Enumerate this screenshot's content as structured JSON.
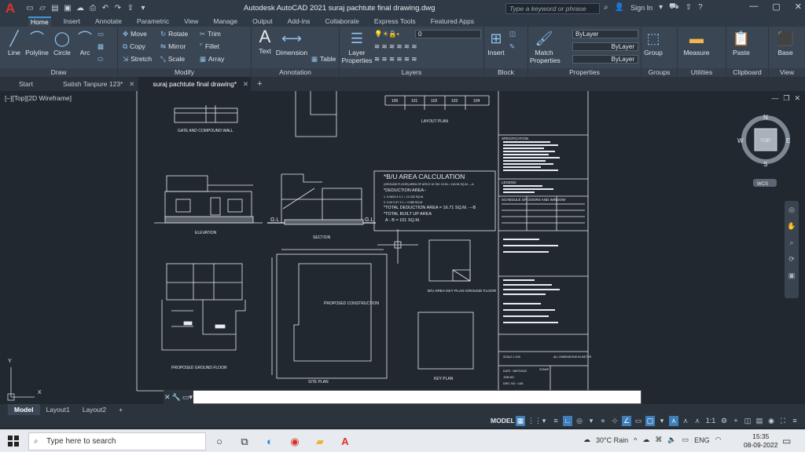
{
  "app": {
    "title": "Autodesk AutoCAD 2021   suraj pachtute final drawing.dwg",
    "search_placeholder": "Type a keyword or phrase",
    "sign_in": "Sign In"
  },
  "ribbon_tabs": [
    "Home",
    "Insert",
    "Annotate",
    "Parametric",
    "View",
    "Manage",
    "Output",
    "Add-ins",
    "Collaborate",
    "Express Tools",
    "Featured Apps"
  ],
  "panels": {
    "draw": {
      "title": "Draw",
      "line": "Line",
      "polyline": "Polyline",
      "circle": "Circle",
      "arc": "Arc"
    },
    "modify": {
      "title": "Modify",
      "move": "Move",
      "rotate": "Rotate",
      "trim": "Trim",
      "copy": "Copy",
      "mirror": "Mirror",
      "fillet": "Fillet",
      "stretch": "Stretch",
      "scale": "Scale",
      "array": "Array"
    },
    "annotation": {
      "title": "Annotation",
      "text": "Text",
      "dimension": "Dimension",
      "table": "Table"
    },
    "layers": {
      "title": "Layers",
      "layer_properties": "Layer Properties",
      "current_layer": "0"
    },
    "block": {
      "title": "Block",
      "insert": "Insert"
    },
    "properties": {
      "title": "Properties",
      "match": "Match Properties",
      "color": "ByLayer",
      "linetype": "ByLayer",
      "lineweight": "ByLayer"
    },
    "groups": {
      "title": "Groups",
      "group": "Group"
    },
    "utilities": {
      "title": "Utilities",
      "measure": "Measure"
    },
    "clipboard": {
      "title": "Clipboard",
      "paste": "Paste"
    },
    "view": {
      "title": "View",
      "base": "Base"
    }
  },
  "doc_tabs": [
    "Start",
    "Satish Tanpure 123*",
    "suraj pachtute final drawing*"
  ],
  "viewport": {
    "label": "[–][Top][2D Wireframe]",
    "viewcube": {
      "top": "TOP",
      "n": "N",
      "s": "S",
      "e": "E",
      "w": "W",
      "wcs": "WCS"
    }
  },
  "drawing": {
    "gate_title": "GATE AND COMPOUND WALL",
    "layout_title": "LAYOUT PLAN",
    "layout_nums": [
      "100",
      "101",
      "102",
      "103",
      "104"
    ],
    "elevation": "ELEVATION",
    "section": "SECTION",
    "gl1": "G.L",
    "gl2": "G.L",
    "calc_title": "*B/U AREA CALCULATION",
    "calc_line1": "(GROUND FLOOR) AREA OF ARCO 10.78X 10.94 = 118.94 SQ.M. ---A",
    "calc_line2": "*DEDUCTION AREA:-",
    "calc_line3": "1. 5.16X2.4 X 1 = 12.432 SQ.M.",
    "calc_line4": "2. 9.4X 0.47 X 1 = 4.368 SQ.M.",
    "calc_line5": "*TOTAL DEDUCTION AREA = 16.71 SQ.M. ---B",
    "calc_line6": "*TOTAL BUILT UP AREA",
    "calc_line7": "A - B = 101 SQ.M.",
    "ground_floor": "PROPOSED GROUND FLOOR",
    "proposed_construction": "PROPOSED CONSTRUCTION",
    "site_plan": "SITE PLAN",
    "bu_key_plan": "B/U AREA KEY PLAN GROUND FLOOR",
    "key_plan": "KEY PLAN",
    "spec": "SPECIFICATION",
    "legend": "LEGEND",
    "schedule": "SCHEDULE OF DOORS AND WINDOW",
    "scale": "SCALE 1:100",
    "dims": "ALL DIMENSIONS IN METER",
    "date": "DATE : 06/07/2022",
    "job": "JOB NO :",
    "drg": "DRG. NO : 1/48",
    "stamp": "STAMP"
  },
  "layout_tabs": [
    "Model",
    "Layout1",
    "Layout2"
  ],
  "status": {
    "model": "MODEL",
    "scale": "1:1"
  },
  "taskbar": {
    "search": "Type here to search",
    "weather": "30°C  Rain",
    "lang": "ENG",
    "time": "15:35",
    "date": "08-09-2022"
  }
}
